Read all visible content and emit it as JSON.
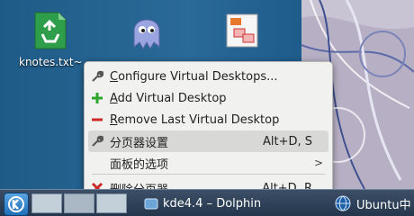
{
  "desktop": {
    "icons": [
      {
        "caption": "knotes.txt~",
        "icon": "recycle-icon"
      },
      {
        "caption": "",
        "icon": "ghost-icon"
      },
      {
        "caption": "",
        "icon": "presentation-icon"
      }
    ]
  },
  "context_menu": {
    "items": [
      {
        "icon": "wrench-icon",
        "label": "Configure Virtual Desktops...",
        "mnemonic": "C",
        "shortcut": ""
      },
      {
        "icon": "plus-icon",
        "label": "Add Virtual Desktop",
        "mnemonic": "A",
        "shortcut": ""
      },
      {
        "icon": "minus-icon",
        "label": "Remove Last Virtual Desktop",
        "mnemonic": "R",
        "shortcut": ""
      },
      {
        "icon": "wrench-icon",
        "label": "分页器设置",
        "shortcut": "Alt+D, S",
        "highlighted": true
      },
      {
        "icon": "",
        "label": "面板的选项",
        "shortcut": "",
        "submenu": true
      },
      {
        "icon": "close-icon",
        "label": "删除分页器",
        "shortcut": "Alt+D, R"
      }
    ]
  },
  "taskbar": {
    "tasks": [
      {
        "label": "kde4.4 – Dolphin",
        "icon": "dolphin-icon"
      },
      {
        "label": "Ubuntu中",
        "icon": "globe-icon"
      }
    ]
  },
  "colors": {
    "accent_green": "#2ea62e",
    "accent_red": "#cc2a2a",
    "menu_bg": "#f1f1f0",
    "taskbar_bg": "#2d3f56"
  }
}
